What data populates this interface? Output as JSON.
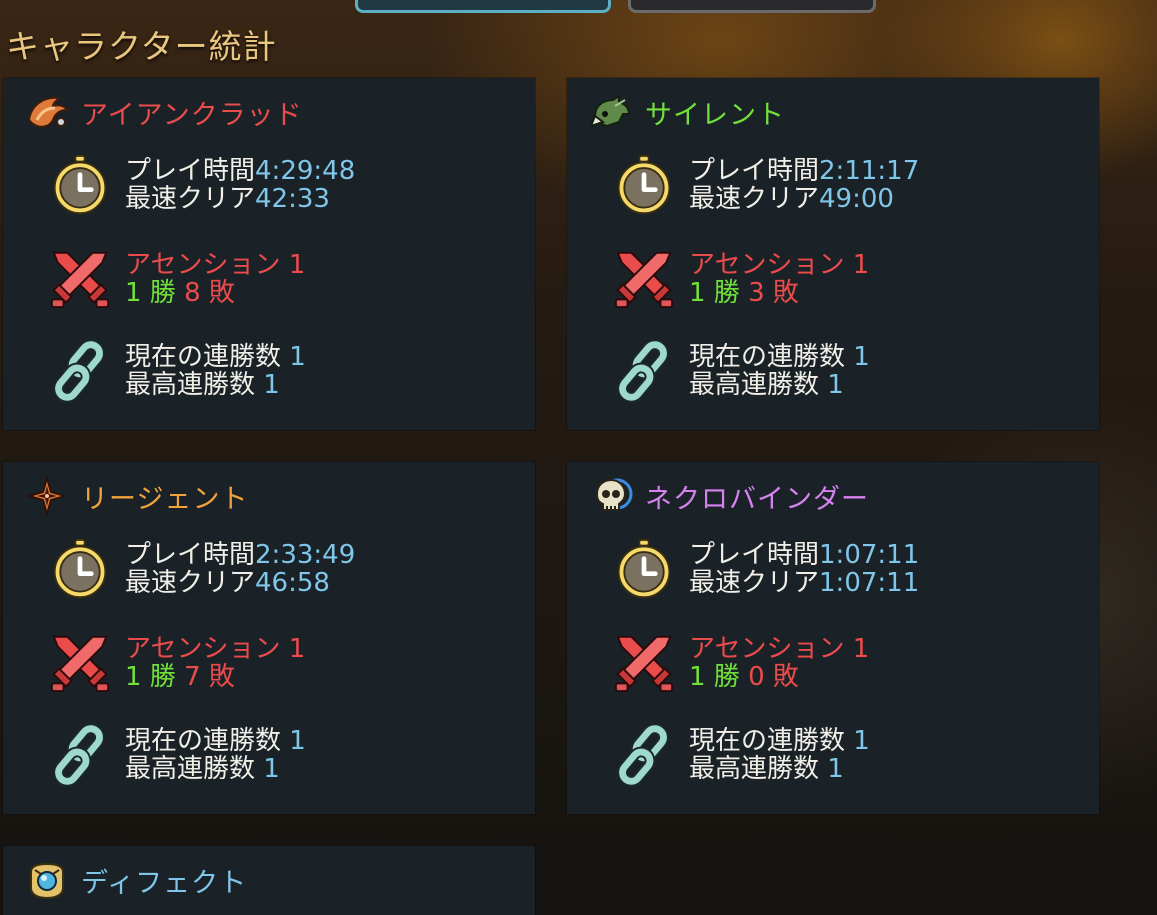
{
  "title": "キャラクター統計",
  "labels": {
    "play_time": "プレイ時間",
    "fastest_clear": "最速クリア",
    "current_streak": "現在の連勝数",
    "best_streak": "最高連勝数"
  },
  "characters": [
    {
      "name": "アイアンクラッド",
      "name_color": "#ea4b4b",
      "icon": "ironclad-icon",
      "play_time": "4:29:48",
      "fastest_clear": "42:33",
      "ascension": "アセンション 1",
      "wins": "1 勝",
      "losses": "8 敗",
      "current_streak": "1",
      "best_streak": "1"
    },
    {
      "name": "サイレント",
      "name_color": "#72e03a",
      "icon": "silent-icon",
      "play_time": "2:11:17",
      "fastest_clear": "49:00",
      "ascension": "アセンション 1",
      "wins": "1 勝",
      "losses": "3 敗",
      "current_streak": "1",
      "best_streak": "1"
    },
    {
      "name": "リージェント",
      "name_color": "#f0a33a",
      "icon": "regent-icon",
      "play_time": "2:33:49",
      "fastest_clear": "46:58",
      "ascension": "アセンション 1",
      "wins": "1 勝",
      "losses": "7 敗",
      "current_streak": "1",
      "best_streak": "1"
    },
    {
      "name": "ネクロバインダー",
      "name_color": "#d582ef",
      "icon": "necrobinder-icon",
      "play_time": "1:07:11",
      "fastest_clear": "1:07:11",
      "ascension": "アセンション 1",
      "wins": "1 勝",
      "losses": "0 敗",
      "current_streak": "1",
      "best_streak": "1"
    },
    {
      "name": "ディフェクト",
      "name_color": "#7fc6e8",
      "icon": "defect-icon"
    }
  ]
}
